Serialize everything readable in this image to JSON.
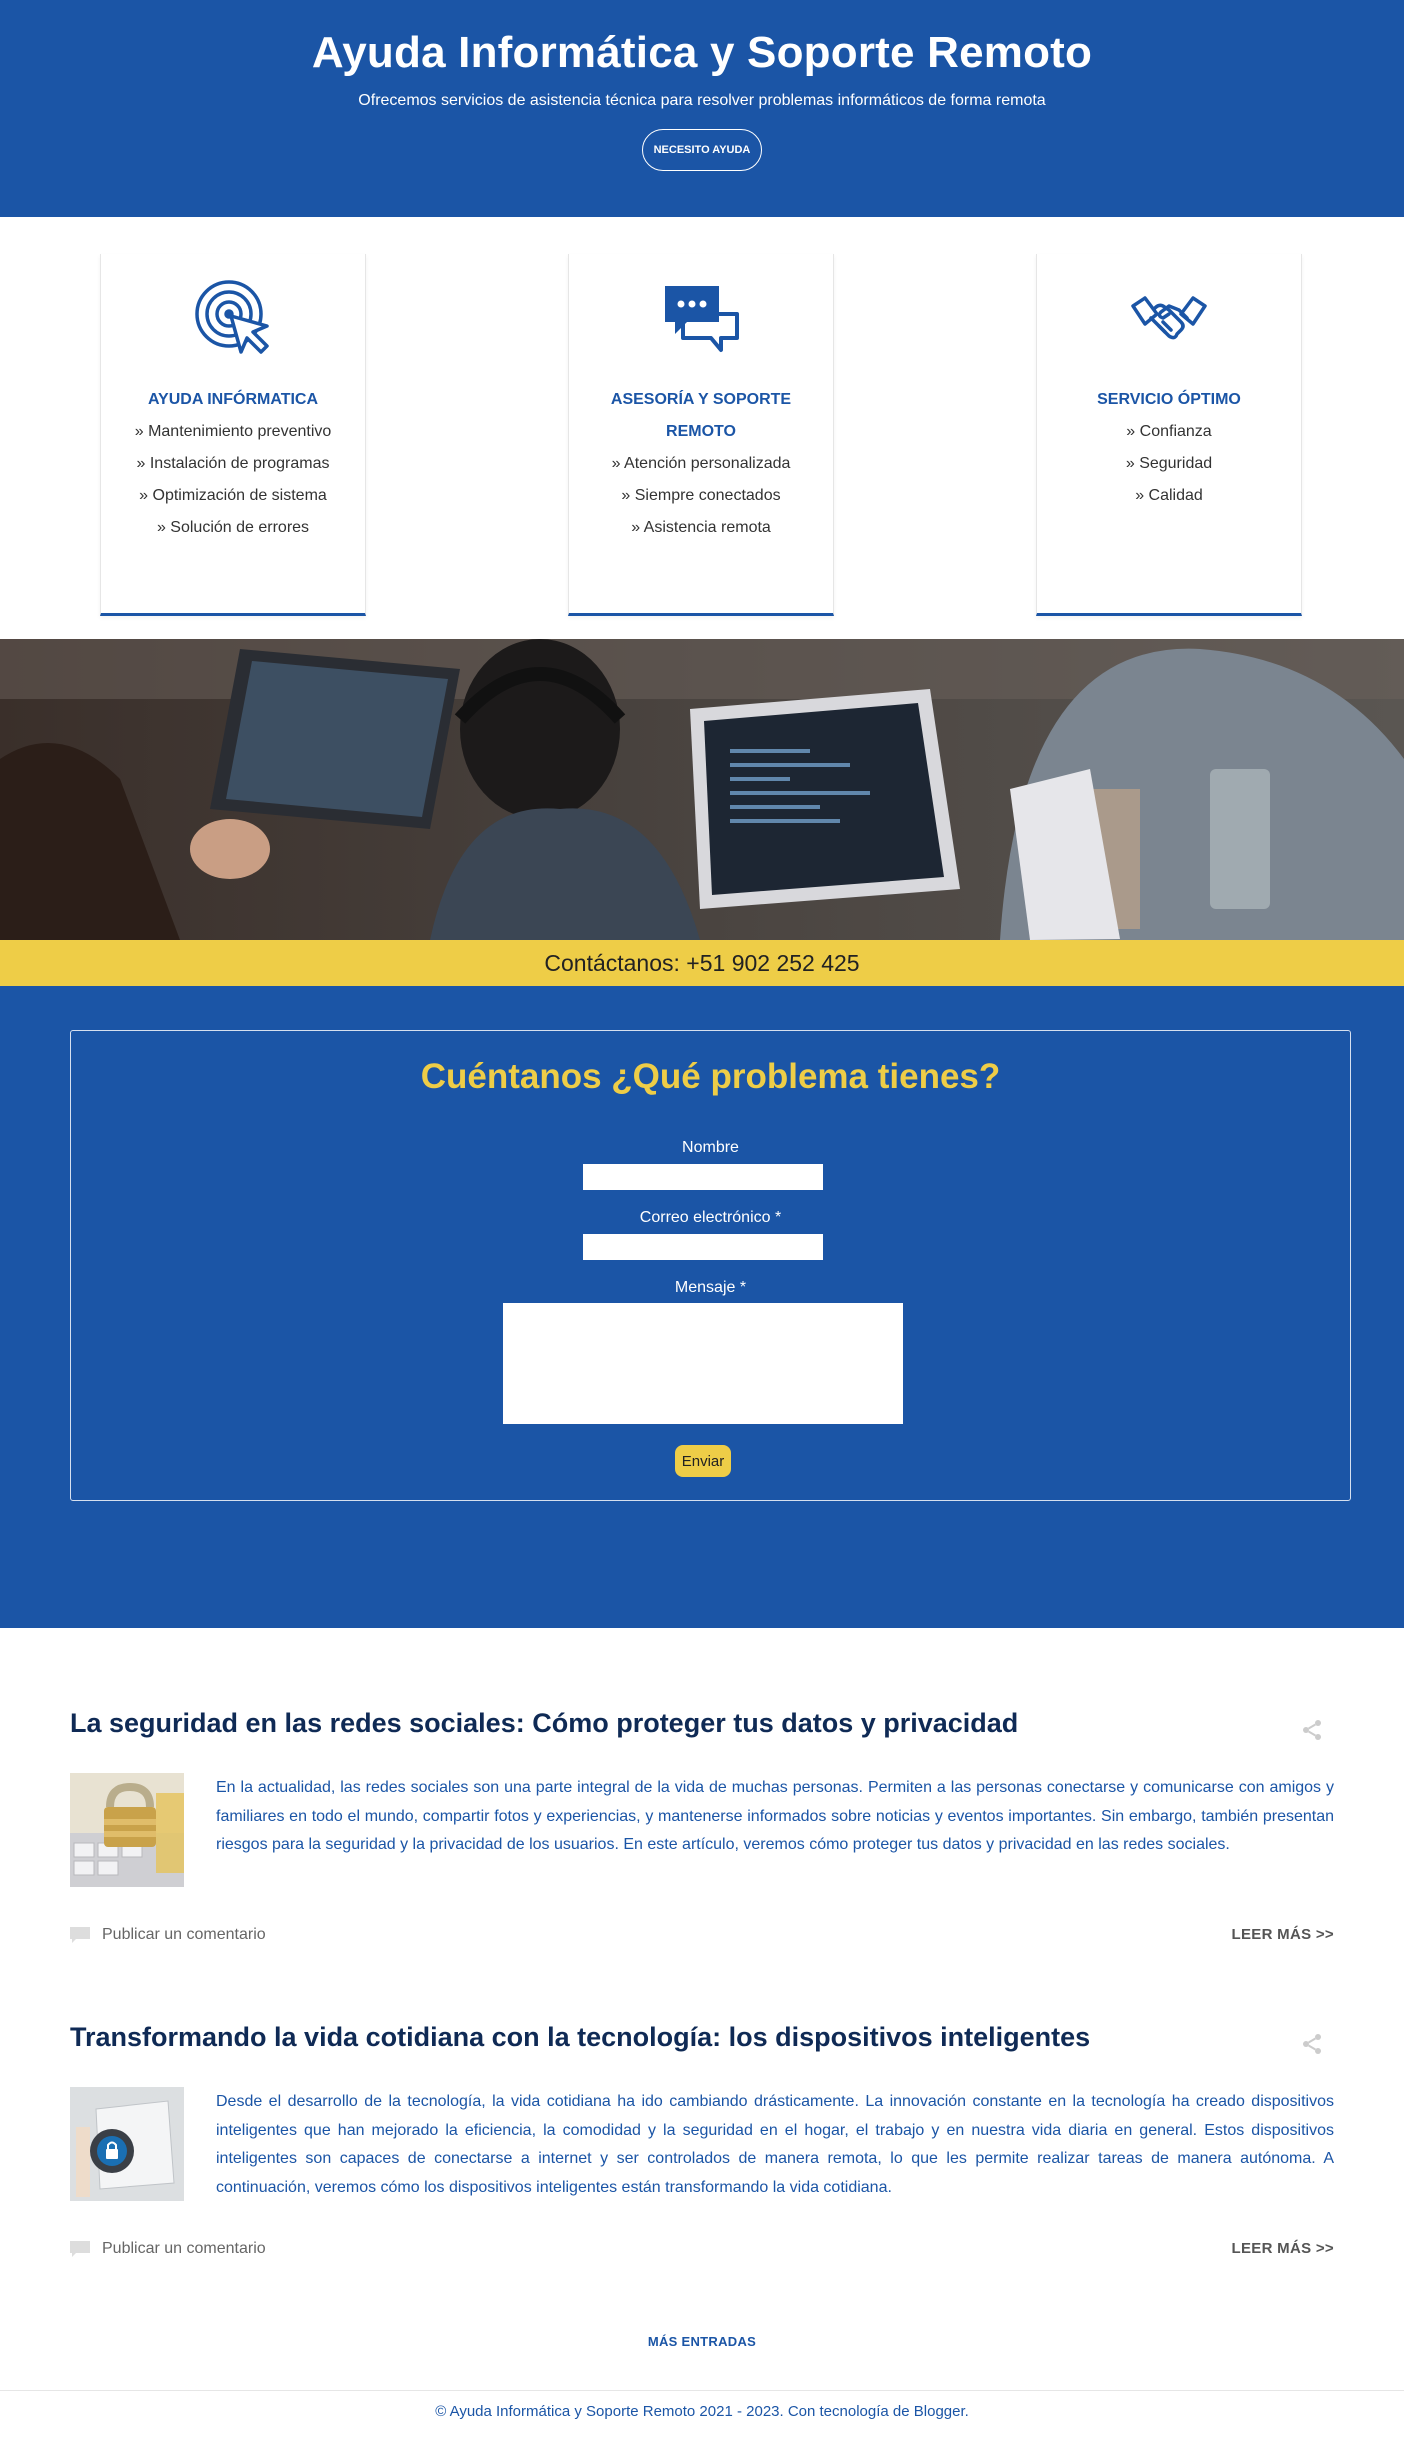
{
  "header": {
    "title": "Ayuda Informática y Soporte Remoto",
    "tagline": "Ofrecemos servicios de asistencia técnica para resolver problemas informáticos de forma remota",
    "cta_label": "NECESITO AYUDA"
  },
  "features": [
    {
      "icon": "target-cursor-icon",
      "title": "AYUDA INFÓRMATICA",
      "items": [
        "» Mantenimiento preventivo",
        "» Instalación de programas",
        "» Optimización de sistema",
        "» Solución de errores"
      ]
    },
    {
      "icon": "chat-bubbles-icon",
      "title": "ASESORÍA Y SOPORTE REMOTO",
      "items": [
        "» Atención personalizada",
        "» Siempre conectados",
        "» Asistencia remota"
      ]
    },
    {
      "icon": "handshake-icon",
      "title": "SERVICIO ÓPTIMO",
      "items": [
        "» Confianza",
        "» Seguridad",
        "» Calidad"
      ]
    }
  ],
  "contact_bar": {
    "text": "Contáctanos: +51 902 252 425"
  },
  "form": {
    "title": "Cuéntanos ¿Qué problema tienes?",
    "name_label": "Nombre",
    "email_label": "Correo electrónico *",
    "message_label": "Mensaje *",
    "name_value": "",
    "email_value": "",
    "message_value": "",
    "submit_label": "Enviar"
  },
  "posts": [
    {
      "title": "La seguridad en las redes sociales: Cómo proteger tus datos y privacidad",
      "excerpt": "En la actualidad, las redes sociales son una parte integral de la vida de muchas personas. Permiten a las personas conectarse y comunicarse con amigos y familiares en todo el mundo, compartir fotos y experiencias, y mantenerse informados sobre noticias y eventos importantes. Sin embargo, también presentan riesgos para la seguridad y la privacidad de los usuarios. En este artículo, veremos cómo proteger tus datos y privacidad en las redes sociales.",
      "comment_label": "Publicar un comentario",
      "read_more": "LEER MÁS >>"
    },
    {
      "title": "Transformando la vida cotidiana con la tecnología: los dispositivos inteligentes",
      "excerpt": "Desde el desarrollo de la tecnología, la vida cotidiana ha ido cambiando drásticamente. La innovación constante en la tecnología ha creado dispositivos inteligentes que han mejorado la eficiencia, la comodidad y la seguridad en el hogar, el trabajo y en nuestra vida diaria en general. Estos dispositivos inteligentes son capaces de conectarse a internet y ser controlados de manera remota, lo que les permite realizar tareas de manera autónoma. A continuación, veremos cómo los dispositivos inteligentes están transformando la vida cotidiana.",
      "comment_label": "Publicar un comentario",
      "read_more": "LEER MÁS >>"
    }
  ],
  "more_label": "MÁS ENTRADAS",
  "footer": {
    "text": "© Ayuda Informática y Soporte Remoto 2021 - 2023. Con tecnología de Blogger."
  },
  "colors": {
    "brand_blue": "#1b55a6",
    "accent_yellow": "#eecd47",
    "title_navy": "#0f2a55"
  }
}
